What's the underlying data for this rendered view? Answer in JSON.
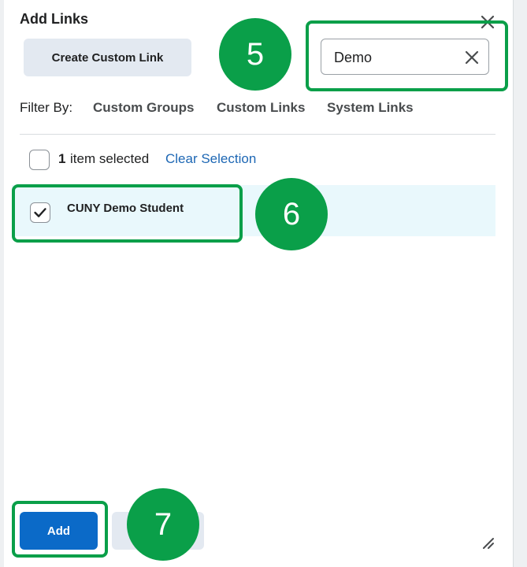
{
  "dialog": {
    "title": "Add Links",
    "create_button_label": "Create Custom Link"
  },
  "search": {
    "value": "Demo"
  },
  "filter": {
    "label": "Filter By:",
    "options": [
      "Custom Groups",
      "Custom Links",
      "System Links"
    ]
  },
  "selection": {
    "count": "1",
    "text": "item selected",
    "clear_label": "Clear Selection"
  },
  "results": [
    {
      "name": "CUNY Demo Student",
      "checked": true
    }
  ],
  "footer": {
    "add_label": "Add",
    "cancel_label": ""
  },
  "annotations": {
    "step_5": "5",
    "step_6": "6",
    "step_7": "7",
    "color": "#0a9f49"
  },
  "colors": {
    "primary": "#0b6ac8",
    "link": "#1d67b4",
    "row_highlight": "#e9f8fc"
  }
}
